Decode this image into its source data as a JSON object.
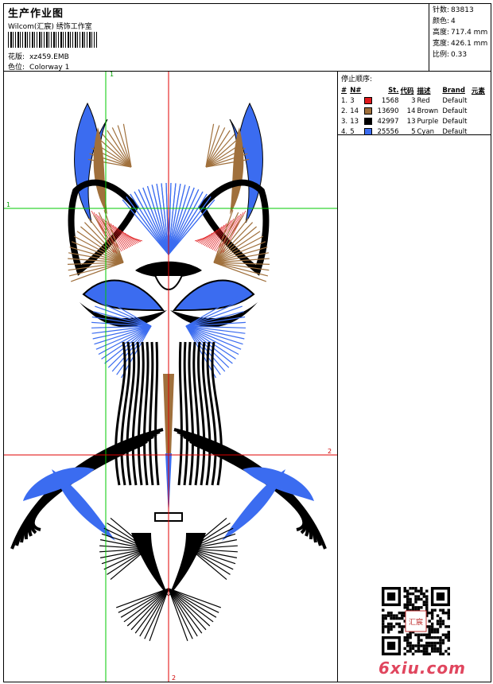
{
  "header": {
    "title": "生产作业图",
    "company": "Wilcom(汇宸) 绣饰工作室",
    "design_label": "花版:",
    "design_value": "xz459.EMB",
    "colorway_label": "色位:",
    "colorway_value": "Colorway 1"
  },
  "stats": [
    {
      "label": "针数:",
      "value": "83813"
    },
    {
      "label": "颜色:",
      "value": "4"
    },
    {
      "label": "高度:",
      "value": "717.4 mm"
    },
    {
      "label": "宽度:",
      "value": "426.1 mm"
    },
    {
      "label": "比例:",
      "value": "0.33"
    }
  ],
  "stop_sequence": {
    "title": "停止顺序:",
    "columns": [
      "#",
      "N#",
      "St.",
      "代码",
      "描述",
      "Brand",
      "元素"
    ],
    "rows": [
      {
        "idx": "1.",
        "n": "3",
        "color": "#e0191c",
        "st": "1568",
        "code": "3",
        "desc": "Red",
        "brand": "Default",
        "elem": ""
      },
      {
        "idx": "2.",
        "n": "14",
        "color": "#a0703c",
        "st": "13690",
        "code": "14",
        "desc": "Brown",
        "brand": "Default",
        "elem": ""
      },
      {
        "idx": "3.",
        "n": "13",
        "color": "#000000",
        "st": "42997",
        "code": "13",
        "desc": "Purple",
        "brand": "Default",
        "elem": ""
      },
      {
        "idx": "4.",
        "n": "5",
        "color": "#3b6cf0",
        "st": "25556",
        "code": "5",
        "desc": "Cyan",
        "brand": "Default",
        "elem": ""
      }
    ]
  },
  "guides": {
    "green_v": "1",
    "green_h": "1",
    "red_h": "2",
    "red_v": "2"
  },
  "colors": {
    "red": "#e0191c",
    "brown": "#a0703c",
    "black": "#000000",
    "blue": "#3b6cf0",
    "green_guide": "#00c800",
    "red_guide": "#e00000"
  },
  "qr": {
    "stamp_text": "汇宸"
  },
  "watermark": "6xiu.com"
}
